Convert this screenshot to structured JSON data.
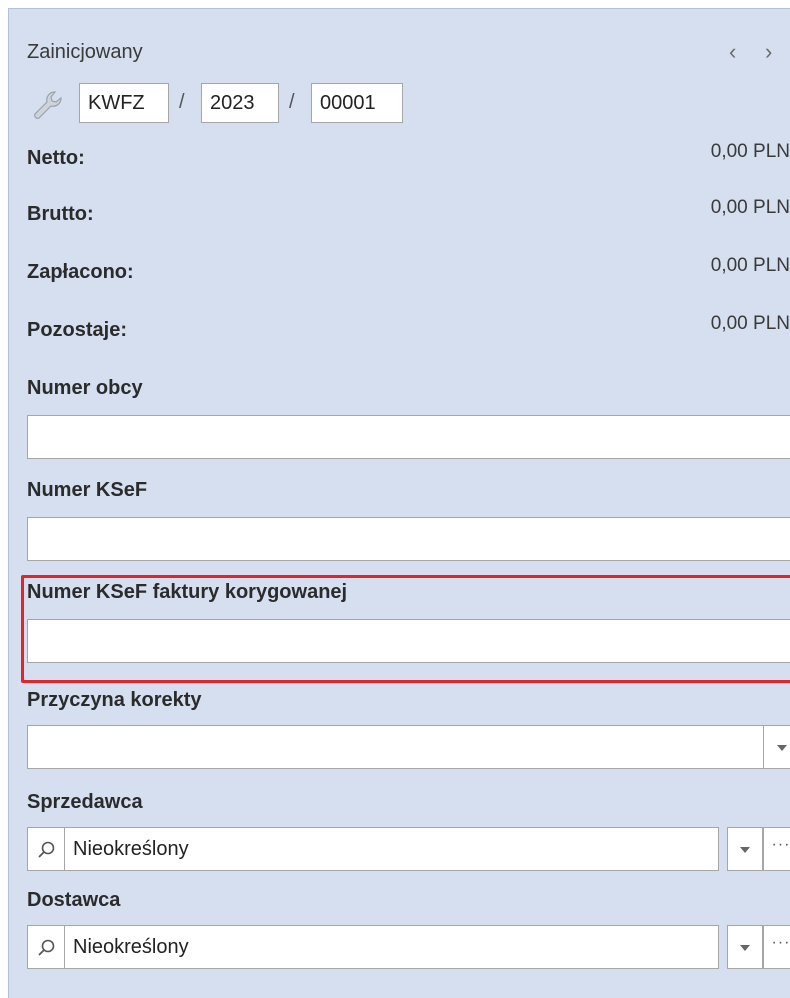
{
  "header": {
    "status": "Zainicjowany",
    "prev_icon": "chevron-left-icon",
    "next_icon": "chevron-right-icon",
    "prev_glyph": "‹",
    "next_glyph": "›"
  },
  "document_number": {
    "settings_icon": "wrench-icon",
    "series": "KWFZ",
    "separator": "/",
    "year": "2023",
    "number": "00001"
  },
  "summary": [
    {
      "label": "Netto:",
      "value": "0,00 PLN"
    },
    {
      "label": "Brutto:",
      "value": "0,00 PLN"
    },
    {
      "label": "Zapłacono:",
      "value": "0,00 PLN"
    },
    {
      "label": "Pozostaje:",
      "value": "0,00 PLN"
    }
  ],
  "fields": {
    "numer_obcy": {
      "label": "Numer obcy",
      "value": ""
    },
    "numer_ksef": {
      "label": "Numer KSeF",
      "value": ""
    },
    "numer_ksef_korygowanej": {
      "label": "Numer KSeF faktury korygowanej",
      "value": ""
    },
    "przyczyna_korekty": {
      "label": "Przyczyna korekty",
      "value": ""
    },
    "sprzedawca": {
      "label": "Sprzedawca",
      "value": "Nieokreślony"
    },
    "dostawca": {
      "label": "Dostawca",
      "value": "Nieokreślony"
    }
  },
  "buttons": {
    "more_glyph": "···"
  },
  "colors": {
    "panel_bg": "#d5dff0",
    "highlight": "#e0262c"
  }
}
